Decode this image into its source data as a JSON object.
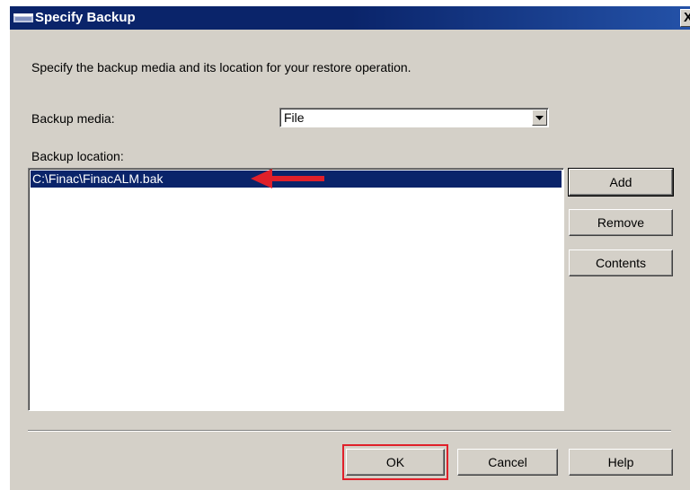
{
  "window": {
    "title": "Specify Backup",
    "close_label": "X"
  },
  "intro_text": "Specify the backup media and its location for your restore operation.",
  "backup_media": {
    "label": "Backup media:",
    "selected": "File"
  },
  "backup_location": {
    "label": "Backup location:",
    "items": [
      "C:\\Finac\\FinacALM.bak"
    ]
  },
  "side_buttons": {
    "add": "Add",
    "remove": "Remove",
    "contents": "Contents"
  },
  "footer_buttons": {
    "ok": "OK",
    "cancel": "Cancel",
    "help": "Help"
  },
  "colors": {
    "titlebar": "#0a246a",
    "selection": "#0a246a",
    "annotation": "#e0202a",
    "dialog_bg": "#d4d0c8"
  },
  "icons": {
    "window": "window-icon",
    "dropdown": "chevron-down-icon",
    "annotation": "red-arrow-left-icon"
  }
}
